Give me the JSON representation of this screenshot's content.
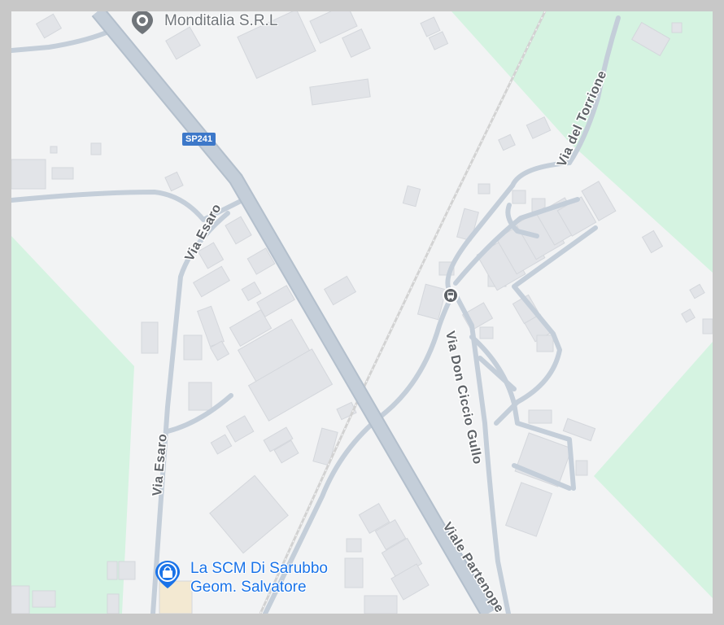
{
  "colors": {
    "land": "#f2f3f4",
    "green": "#d5f3e1",
    "road": "#c4ced9",
    "road_edge": "#b3bfcc",
    "building": "#e2e4e8",
    "building_edge": "#d4d7dc",
    "railway": "#c9c9c9",
    "poi_gray": "#70757a",
    "poi_blue": "#1a73e8",
    "road_text": "#5f6368"
  },
  "pois": [
    {
      "name": "Monditalia S.R.L",
      "icon": "map-pin-icon"
    },
    {
      "name_line1": "La SCM Di Sarubbo",
      "name_line2": "Geom. Salvatore",
      "icon": "shopping-bag-icon"
    }
  ],
  "road_shield": "SP241",
  "street_labels": {
    "via_esaro_1": "Via Esaro",
    "via_esaro_2": "Via Esaro",
    "via_del_torrione": "Via del Torrione",
    "via_don_ciccio_gullo": "Via Don Ciccio Gullo",
    "viale_partenope": "Viale Partenope"
  },
  "transit_icon": "bus-stop-icon"
}
